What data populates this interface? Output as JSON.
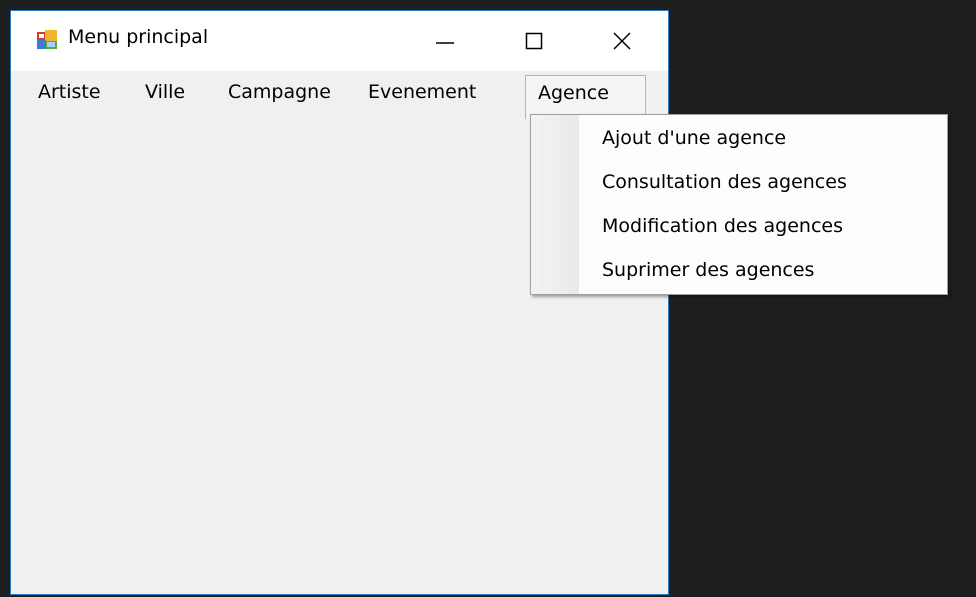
{
  "window": {
    "title": "Menu principal"
  },
  "menubar": {
    "items": [
      "Artiste",
      "Ville",
      "Campagne",
      "Evenement",
      "Agence"
    ]
  },
  "dropdown": {
    "items": [
      "Ajout d'une agence",
      "Consultation des agences",
      "Modification des agences",
      "Suprimer des agences"
    ]
  },
  "icons": {
    "app": "form-app-icon",
    "minimize": "minimize-icon",
    "maximize": "maximize-icon",
    "close": "close-icon"
  },
  "colors": {
    "window_border": "#2b79c2",
    "background": "#1e1e1e",
    "client": "#f0f0f0"
  }
}
